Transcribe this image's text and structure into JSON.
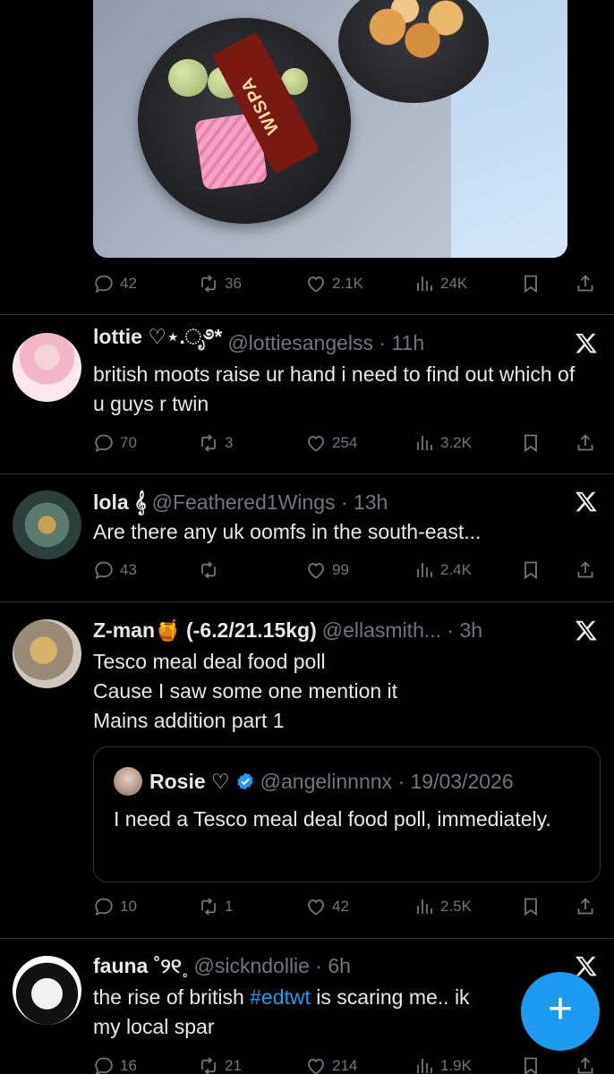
{
  "post0": {
    "stats": {
      "replies": "42",
      "reposts": "36",
      "likes": "2.1K",
      "views": "24K"
    },
    "image_text": "WISPA"
  },
  "post1": {
    "name": "lottie ♡⋆.ೃ࿔*",
    "handle": "@lottiesangelss · 11h",
    "text": "british moots raise ur hand i need to find out which of u guys r twin",
    "stats": {
      "replies": "70",
      "reposts": "3",
      "likes": "254",
      "views": "3.2K"
    }
  },
  "post2": {
    "name": "lola 𝄞",
    "handle": "@Feathered1Wings · 13h",
    "text": "Are there any uk oomfs in the south-east...",
    "stats": {
      "replies": "43",
      "reposts": "",
      "likes": "99",
      "views": "2.4K"
    }
  },
  "post3": {
    "name": "Z-man🍯 (-6.2/21.15kg)",
    "handle": "@ellasmith... · 3h",
    "text_lines": [
      "Tesco meal deal food poll",
      "Cause I saw some one mention it",
      "Mains addition part 1"
    ],
    "quote": {
      "name": "Rosie ♡",
      "handle": "@angelinnnnx · 19/03/2026",
      "text": "I need a Tesco meal deal food poll, immediately."
    },
    "stats": {
      "replies": "10",
      "reposts": "1",
      "likes": "42",
      "views": "2.5K"
    }
  },
  "post4": {
    "name": "fauna ˚୨୧˳",
    "handle": "@sickndollie · 6h",
    "text_before": "the rise of british ",
    "hashtag": "#edtwt",
    "text_after": " is scaring me.. ik ",
    "text_line2": "my local spar",
    "stats": {
      "replies": "16",
      "reposts": "21",
      "likes": "214",
      "views": "1.9K"
    }
  },
  "icons": [
    "reply-icon",
    "repost-icon",
    "like-icon",
    "views-icon",
    "bookmark-icon",
    "share-icon",
    "x-logo-icon",
    "verified-icon",
    "compose-plus-icon"
  ],
  "colors": {
    "background": "#000000",
    "text": "#e7e9ea",
    "muted": "#71767b",
    "accent": "#1d9bf0",
    "divider": "#2f3336"
  },
  "fab": {
    "label": "+"
  }
}
